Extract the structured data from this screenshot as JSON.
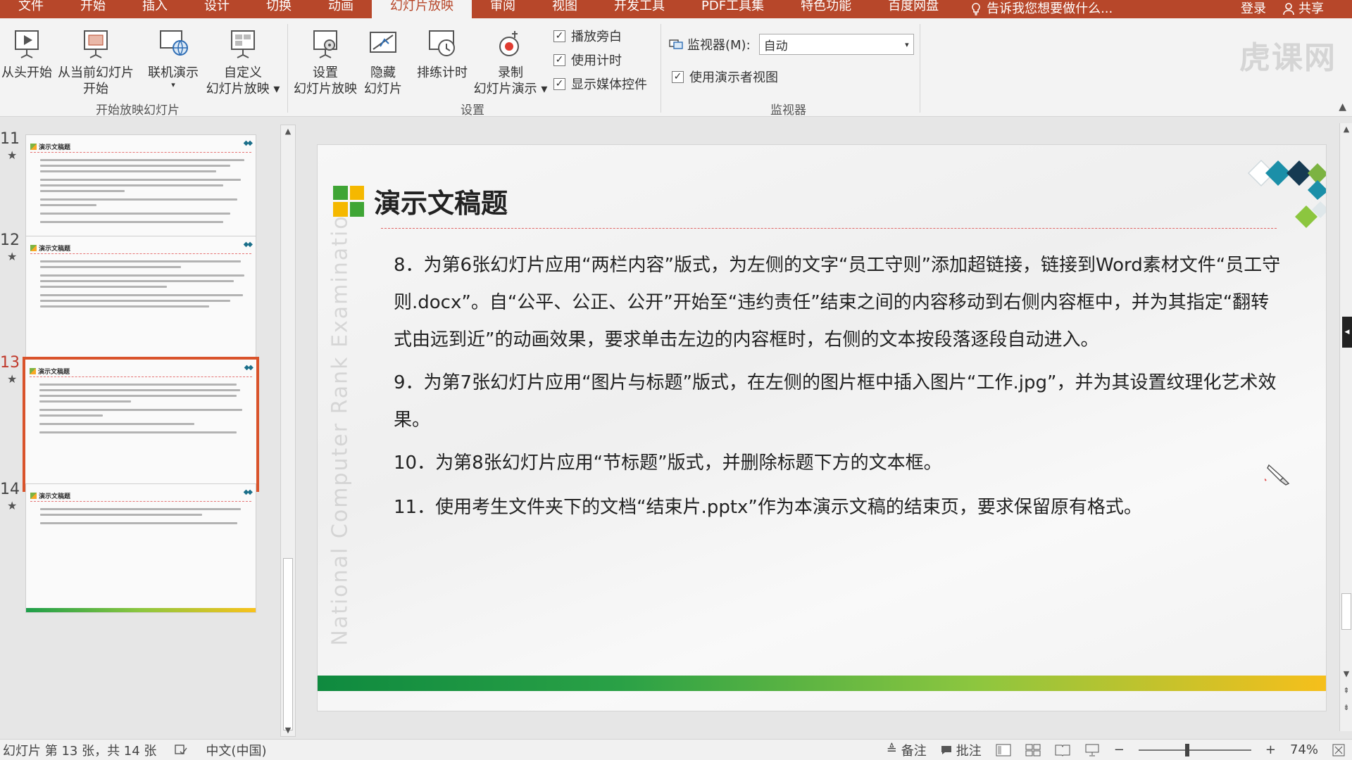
{
  "tabs": [
    "文件",
    "开始",
    "插入",
    "设计",
    "切换",
    "动画",
    "幻灯片放映",
    "审阅",
    "视图",
    "开发工具",
    "PDF工具集",
    "特色功能",
    "百度网盘"
  ],
  "active_tab_index": 6,
  "tell_me": "告诉我您想要做什么...",
  "login": "登录",
  "share": "共享",
  "watermark": "虎课网",
  "ribbon": {
    "btn_from_start": "从头开始",
    "btn_from_current_1": "从当前幻灯片",
    "btn_from_current_2": "开始",
    "btn_online": "联机演示",
    "btn_custom_1": "自定义",
    "btn_custom_2": "幻灯片放映",
    "group_start": "开始放映幻灯片",
    "btn_setup_1": "设置",
    "btn_setup_2": "幻灯片放映",
    "btn_hide_1": "隐藏",
    "btn_hide_2": "幻灯片",
    "btn_rehearse": "排练计时",
    "btn_record_1": "录制",
    "btn_record_2": "幻灯片演示",
    "chk_narration": "播放旁白",
    "chk_timing": "使用计时",
    "chk_media": "显示媒体控件",
    "group_setup": "设置",
    "monitor_label": "监视器(M):",
    "monitor_value": "自动",
    "chk_presenter": "使用演示者视图",
    "group_monitor": "监视器"
  },
  "thumbnails": [
    {
      "num": "11",
      "title": "演示文稿题"
    },
    {
      "num": "12",
      "title": "演示文稿题"
    },
    {
      "num": "13",
      "title": "演示文稿题"
    },
    {
      "num": "14",
      "title": "演示文稿题"
    }
  ],
  "slide": {
    "title": "演示文稿题",
    "vertical_watermark": "National Computer Rank Examination",
    "paragraphs": [
      "8．为第6张幻灯片应用“两栏内容”版式，为左侧的文字“员工守则”添加超链接，链接到Word素材文件“员工守则.docx”。自“公平、公正、公开”开始至“违约责任”结束之间的内容移动到右侧内容框中，并为其指定“翻转式由远到近”的动画效果，要求单击左边的内容框时，右侧的文本按段落逐段自动进入。",
      "9．为第7张幻灯片应用“图片与标题”版式，在左侧的图片框中插入图片“工作.jpg”，并为其设置纹理化艺术效果。",
      "10．为第8张幻灯片应用“节标题”版式，并删除标题下方的文本框。",
      "11．使用考生文件夹下的文档“结束片.pptx”作为本演示文稿的结束页，要求保留原有格式。"
    ]
  },
  "status": {
    "slide_info": "幻灯片 第 13 张，共 14 张",
    "language": "中文(中国)",
    "notes": "备注",
    "comments": "批注",
    "zoom": "74%"
  }
}
